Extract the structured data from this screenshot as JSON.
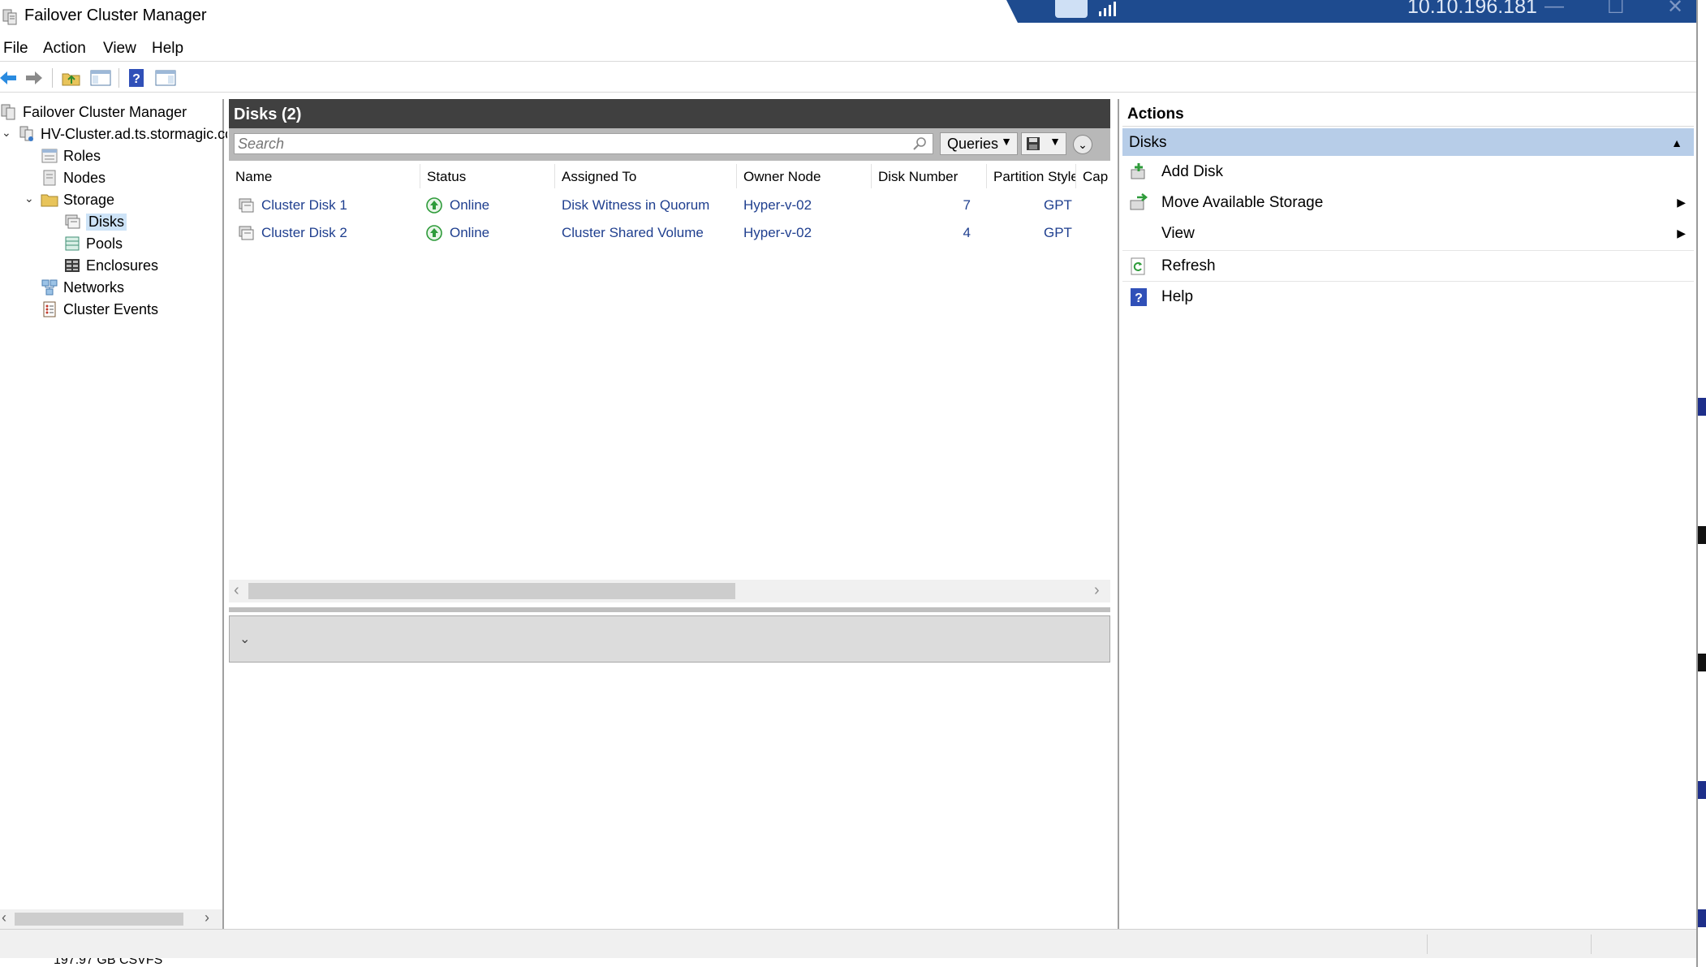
{
  "window": {
    "title": "Failover Cluster Manager",
    "remote_ip": "10.10.196.181",
    "window_controls": [
      "—",
      "☐",
      "✕"
    ]
  },
  "menu": [
    "File",
    "Action",
    "View",
    "Help"
  ],
  "toolbar": {
    "buttons": [
      "back-icon",
      "forward-icon",
      "up-folder-icon",
      "show-hide-console-tree-icon",
      "help-icon",
      "show-hide-action-pane-icon"
    ]
  },
  "tree": {
    "root": "Failover Cluster Manager",
    "cluster": "HV-Cluster.ad.ts.stormagic.co",
    "roles": "Roles",
    "nodes": "Nodes",
    "storage": "Storage",
    "disks": "Disks",
    "pools": "Pools",
    "enclosures": "Enclosures",
    "networks": "Networks",
    "events": "Cluster Events"
  },
  "center": {
    "header": "Disks (2)",
    "search_placeholder": "Search",
    "queries_label": "Queries",
    "columns": [
      "Name",
      "Status",
      "Assigned To",
      "Owner Node",
      "Disk Number",
      "Partition Style",
      "Cap"
    ],
    "rows": [
      {
        "name": "Cluster Disk 1",
        "status": "Online",
        "assigned": "Disk Witness in Quorum",
        "owner": "Hyper-v-02",
        "disk_number": "7",
        "partition": "GPT"
      },
      {
        "name": "Cluster Disk 2",
        "status": "Online",
        "assigned": "Cluster Shared Volume",
        "owner": "Hyper-v-02",
        "disk_number": "4",
        "partition": "GPT"
      }
    ]
  },
  "actions": {
    "header": "Actions",
    "section": "Disks",
    "add_disk": "Add Disk",
    "move_storage": "Move Available Storage",
    "view": "View",
    "refresh": "Refresh",
    "help": "Help"
  },
  "behind_text": "197.97 GB CSVFS",
  "colors": {
    "accent_blue": "#1e4b8f",
    "selection": "#cde3f7",
    "actions_section": "#b7cde8",
    "link_text": "#1f3f8f",
    "online_green": "#2e9b3a"
  }
}
